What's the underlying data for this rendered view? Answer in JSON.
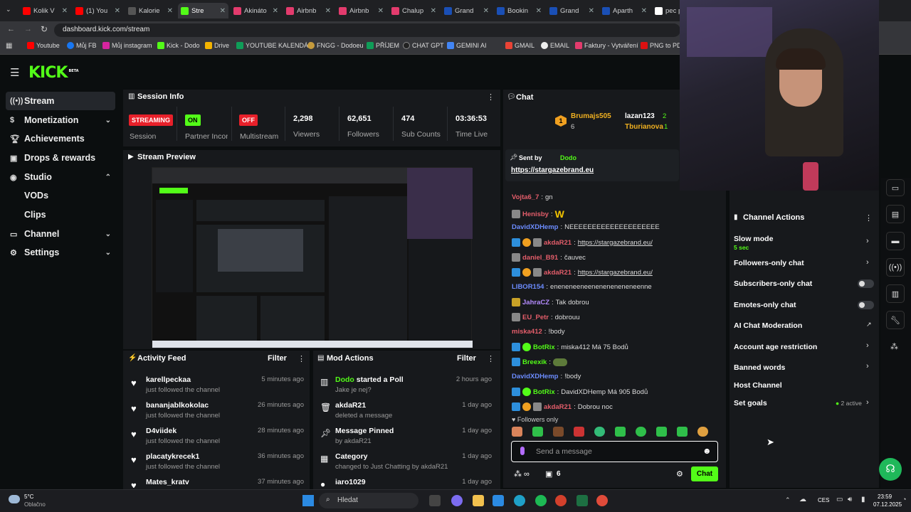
{
  "browser": {
    "tabs": [
      "Kolik V",
      "(1) You",
      "Kalorie",
      "Stre",
      "Akináto",
      "Airbnb",
      "Airbnb",
      "Chalup",
      "Grand",
      "Bookin",
      "Grand",
      "Aparth",
      "pec p"
    ],
    "url": "dashboard.kick.com/stream",
    "bookmarks": [
      "Youtube",
      "Můj FB",
      "Můj instagram",
      "Kick - Dodo",
      "Drive",
      "YOUTUBE KALENDÁŘ",
      "FNGG - Dodoeu",
      "PŘÍJEM",
      "CHAT GPT",
      "GEMINI AI",
      "GMAIL",
      "EMAIL",
      "Faktury - Vytváření",
      "PNG to PDF"
    ]
  },
  "sidebar": {
    "logo": "KICK",
    "logo_sup": "BETA",
    "items": [
      {
        "label": "Stream",
        "icon": "stream-icon"
      },
      {
        "label": "Monetization"
      },
      {
        "label": "Achievements"
      },
      {
        "label": "Drops & rewards"
      },
      {
        "label": "Studio"
      },
      {
        "label": "VODs"
      },
      {
        "label": "Clips"
      },
      {
        "label": "Channel"
      },
      {
        "label": "Settings"
      }
    ]
  },
  "session": {
    "title": "Session Info",
    "streaming": "STREAMING",
    "session_label": "Session",
    "partner_badge": "ON",
    "partner_label": "Partner Income",
    "multistream_badge": "OFF",
    "multistream_label": "Multistream",
    "viewers": "2,298",
    "viewers_label": "Viewers",
    "followers": "62,651",
    "followers_label": "Followers",
    "subs": "474",
    "subs_label": "Sub Counts",
    "time": "03:36:53",
    "time_label": "Time Live"
  },
  "preview": {
    "title": "Stream Preview"
  },
  "activity": {
    "title": "Activity Feed",
    "filter": "Filter",
    "items": [
      {
        "name": "karellpeckaa",
        "sub": "just followed the channel",
        "time": "5 minutes ago"
      },
      {
        "name": "bananjablkokolac",
        "sub": "just followed the channel",
        "time": "26 minutes ago"
      },
      {
        "name": "D4viidek",
        "sub": "just followed the channel",
        "time": "28 minutes ago"
      },
      {
        "name": "placatykrecek1",
        "sub": "just followed the channel",
        "time": "36 minutes ago"
      },
      {
        "name": "Mates_kratv",
        "sub": "",
        "time": "37 minutes ago"
      }
    ]
  },
  "mod": {
    "title": "Mod Actions",
    "filter": "Filter",
    "items": [
      {
        "name": "Dodo",
        "action": "started a Poll",
        "sub": "Jake je nej?",
        "time": "2 hours ago"
      },
      {
        "name": "akdaR21",
        "action": "",
        "sub": "deleted a message",
        "time": "1 day ago"
      },
      {
        "name": "Message Pinned",
        "action": "",
        "sub": "by akdaR21",
        "time": "1 day ago"
      },
      {
        "name": "Category",
        "action": "",
        "sub": "changed to Just Chatting by akdaR21",
        "time": "1 day ago"
      },
      {
        "name": "iaro1029",
        "action": "",
        "sub": "",
        "time": "1 day ago"
      }
    ]
  },
  "chat": {
    "title": "Chat",
    "leaders": [
      {
        "name": "Brumajs505",
        "count": "6"
      },
      {
        "name": "lazan123",
        "count": "2"
      },
      {
        "name": "Tburianova",
        "count": "1"
      }
    ],
    "pinned_by": "Sent by",
    "pinned_user": "Dodo",
    "pinned_link": "https://stargazebrand.eu",
    "messages": [
      {
        "user": "Vojta6_7",
        "color": "#e35d6a",
        "text": "gn"
      },
      {
        "user": "Henisby",
        "color": "#e35d6a",
        "text": "W"
      },
      {
        "user": "DavidXDHemp",
        "color": "#6c8cff",
        "text": "NEEEEEEEEEEEEEEEEEEEE"
      },
      {
        "user": "akdaR21",
        "color": "#e35d6a",
        "text": "https://stargazebrand.eu/"
      },
      {
        "user": "daniel_B91",
        "color": "#e35d6a",
        "text": "čauvec"
      },
      {
        "user": "akdaR21",
        "color": "#e35d6a",
        "text": "https://stargazebrand.eu/"
      },
      {
        "user": "LIBOR154",
        "color": "#6c8cff",
        "text": "eneneneeneeneneneneneneenne"
      },
      {
        "user": "JahraCZ",
        "color": "#b58cff",
        "text": "Tak dobrou"
      },
      {
        "user": "EU_Petr",
        "color": "#e35d6a",
        "text": "dobrouu"
      },
      {
        "user": "miska412",
        "color": "#e35d6a",
        "text": "!body"
      },
      {
        "user": "BotRix",
        "color": "#53fc18",
        "text": "miska412 Má 75 Bodů"
      },
      {
        "user": "Breexik",
        "color": "#53fc18",
        "text": ""
      },
      {
        "user": "DavidXDHemp",
        "color": "#6c8cff",
        "text": "!body"
      },
      {
        "user": "BotRix",
        "color": "#53fc18",
        "text": "DavidXDHemp Má 905 Bodů"
      },
      {
        "user": "akdaR21",
        "color": "#e35d6a",
        "text": "Dobrou noc"
      }
    ],
    "followers_only": "Followers only",
    "placeholder": "Send a message",
    "points": "6",
    "send": "Chat"
  },
  "actions": {
    "title": "Channel Actions",
    "slow": "Slow mode",
    "slow_sub": "5 sec",
    "followers": "Followers-only chat",
    "subs": "Subscribers-only chat",
    "emotes": "Emotes-only chat",
    "ai": "AI Chat Moderation",
    "age": "Account age restriction",
    "banned": "Banned words",
    "host": "Host Channel",
    "goals": "Set goals",
    "goals_active": "2 active"
  },
  "taskbar": {
    "temp": "5°C",
    "weather": "Oblačno",
    "search": "Hledat",
    "lang": "CES",
    "time": "23:59",
    "date": "07.12.2025"
  },
  "colors": {
    "kick_green": "#53fc18",
    "streaming_red": "#e8202a"
  }
}
